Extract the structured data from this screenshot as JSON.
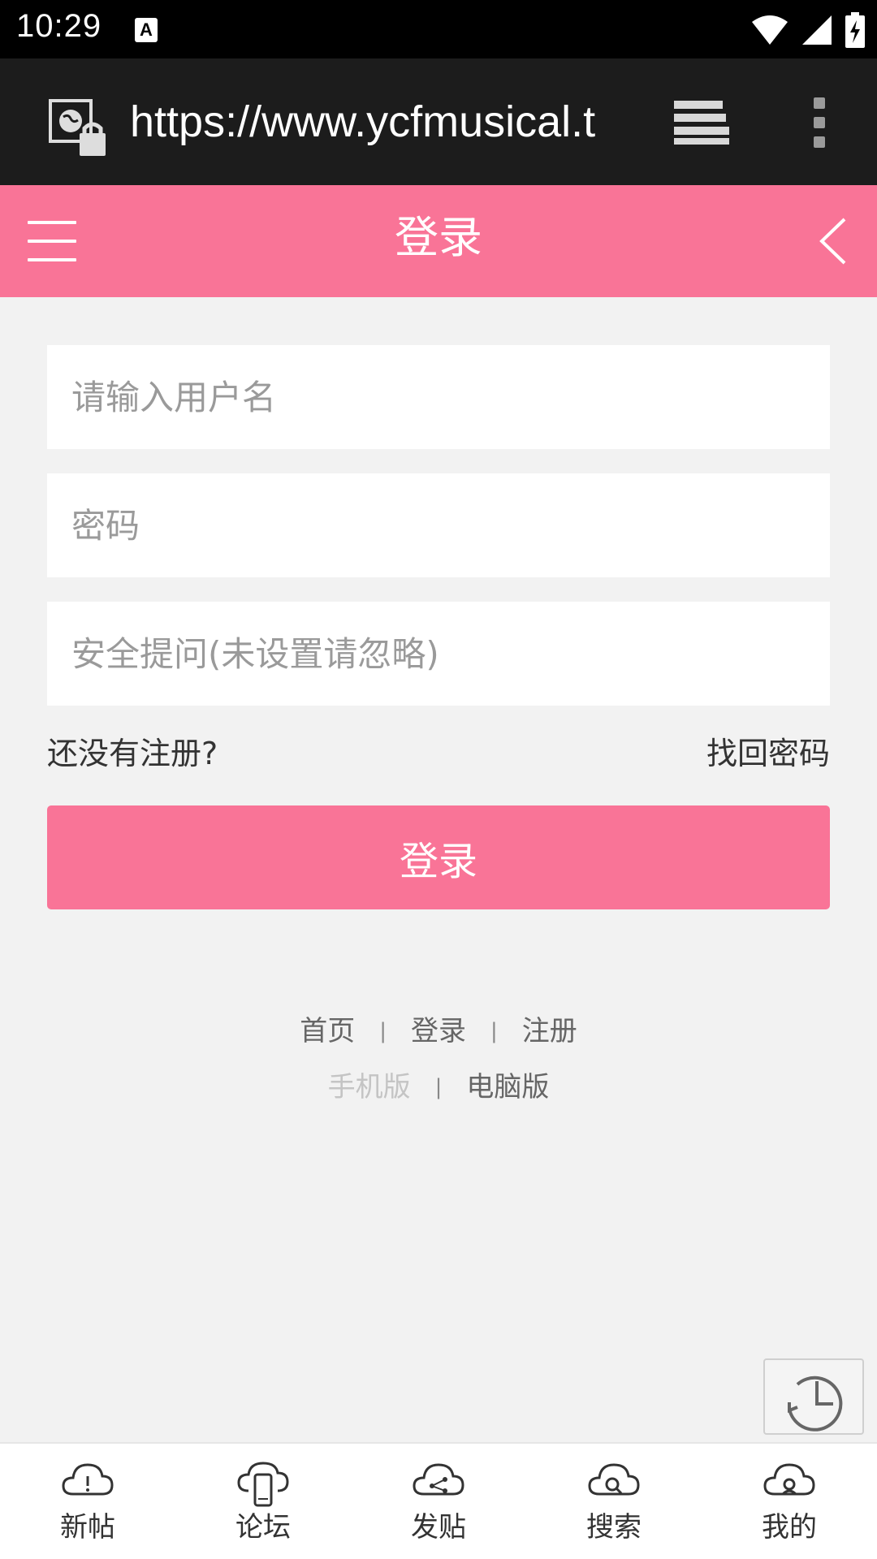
{
  "status_bar": {
    "time": "10:29",
    "notification_badge": "A"
  },
  "browser": {
    "url": "https://www.ycfmusical.t"
  },
  "header": {
    "title": "登录"
  },
  "form": {
    "username_placeholder": "请输入用户名",
    "password_placeholder": "密码",
    "security_placeholder": "安全提问(未设置请忽略)",
    "register_link": "还没有注册?",
    "forgot_link": "找回密码",
    "submit_label": "登录"
  },
  "footer": {
    "links1": [
      "首页",
      "登录",
      "注册"
    ],
    "separator": "|",
    "links2": [
      "手机版",
      "电脑版"
    ]
  },
  "bottom_nav": [
    {
      "label": "新帖",
      "icon": "cloud-alert-icon"
    },
    {
      "label": "论坛",
      "icon": "cloud-phone-icon"
    },
    {
      "label": "发贴",
      "icon": "cloud-share-icon"
    },
    {
      "label": "搜索",
      "icon": "cloud-search-icon"
    },
    {
      "label": "我的",
      "icon": "cloud-user-icon"
    }
  ],
  "colors": {
    "accent": "#f97497",
    "background": "#f2f2f2"
  }
}
